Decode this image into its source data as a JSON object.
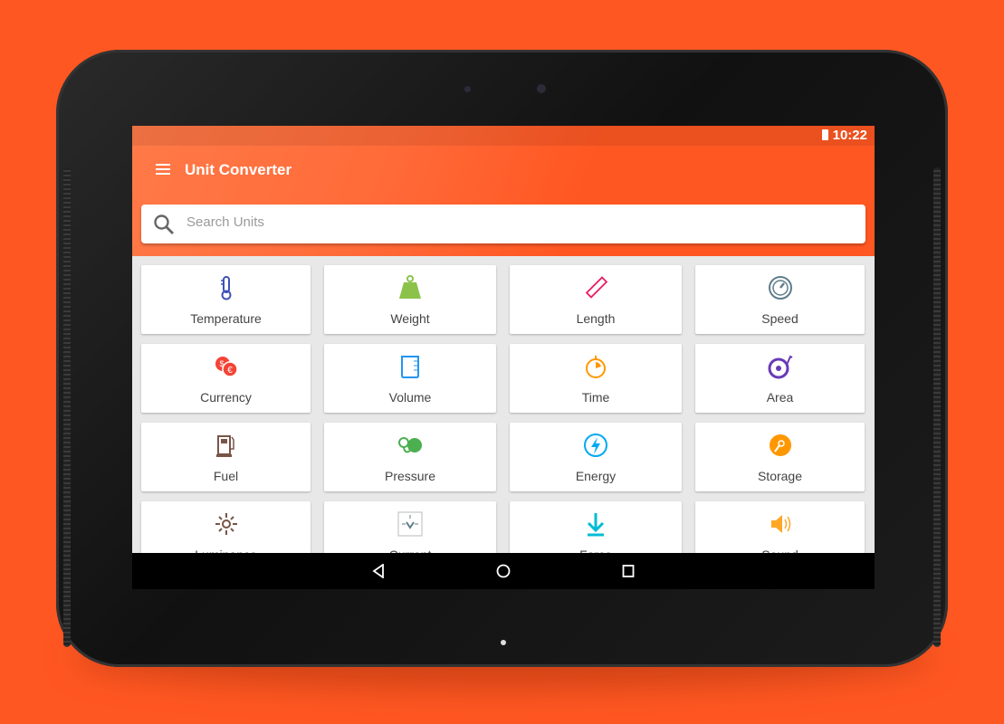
{
  "status_bar": {
    "time": "10:22",
    "battery_icon": "battery-icon"
  },
  "app_bar": {
    "title": "Unit Converter",
    "menu_icon": "hamburger-menu-icon",
    "accent_color": "#ff5722"
  },
  "search": {
    "placeholder": "Search Units",
    "value": ""
  },
  "categories": [
    {
      "label": "Temperature",
      "icon": "thermometer",
      "color": "#3f51b5"
    },
    {
      "label": "Weight",
      "icon": "weight",
      "color": "#8bc34a"
    },
    {
      "label": "Length",
      "icon": "ruler",
      "color": "#e91e63"
    },
    {
      "label": "Speed",
      "icon": "speedometer",
      "color": "#607d8b"
    },
    {
      "label": "Currency",
      "icon": "currency",
      "color": "#f44336"
    },
    {
      "label": "Volume",
      "icon": "beaker",
      "color": "#2196f3"
    },
    {
      "label": "Time",
      "icon": "stopwatch",
      "color": "#ff9800"
    },
    {
      "label": "Area",
      "icon": "tape-measure",
      "color": "#673ab7"
    },
    {
      "label": "Fuel",
      "icon": "fuel-pump",
      "color": "#795548"
    },
    {
      "label": "Pressure",
      "icon": "pressure",
      "color": "#4caf50"
    },
    {
      "label": "Energy",
      "icon": "lightning",
      "color": "#03a9f4"
    },
    {
      "label": "Storage",
      "icon": "disc",
      "color": "#ff9800"
    },
    {
      "label": "Luminance",
      "icon": "sun",
      "color": "#795548"
    },
    {
      "label": "Current",
      "icon": "bulb",
      "color": "#607d8b"
    },
    {
      "label": "Force",
      "icon": "download-arrow",
      "color": "#00bcd4"
    },
    {
      "label": "Sound",
      "icon": "speaker",
      "color": "#ffa726"
    }
  ],
  "nav_bar": {
    "back": "back-icon",
    "home": "home-icon",
    "recents": "recents-icon"
  }
}
